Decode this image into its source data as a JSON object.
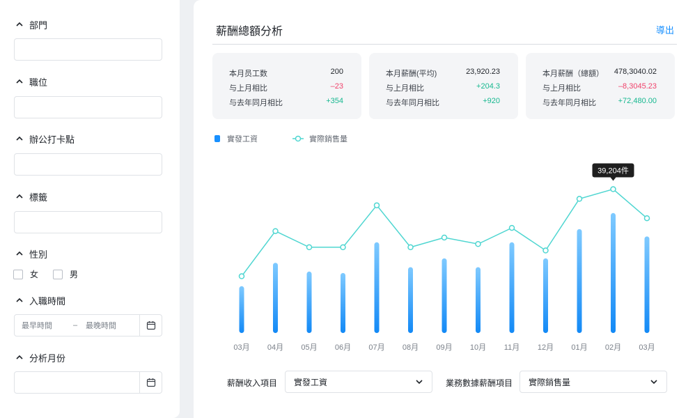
{
  "filters": {
    "department": {
      "title": "部門"
    },
    "position": {
      "title": "職位"
    },
    "office": {
      "title": "辦公打卡點"
    },
    "tags": {
      "title": "標籤"
    },
    "gender": {
      "title": "性別",
      "options": [
        "女",
        "男"
      ]
    },
    "hire_date": {
      "title": "入職時間",
      "start_placeholder": "最早時間",
      "separator": "–",
      "end_placeholder": "最晚時間"
    },
    "month": {
      "title": "分析月份"
    }
  },
  "header": {
    "title": "薪酬總額分析",
    "export_label": "導出"
  },
  "cards": [
    {
      "rows": [
        {
          "label": "本月员工数",
          "value": "200"
        },
        {
          "label": "与上月相比",
          "value": "–23"
        },
        {
          "label": "与去年同月相比",
          "value": "+354"
        }
      ]
    },
    {
      "rows": [
        {
          "label": "本月薪酬(平均)",
          "value": "23,920.23"
        },
        {
          "label": "与上月相比",
          "value": "+204.3"
        },
        {
          "label": "与去年同月相比",
          "value": "+920"
        }
      ]
    },
    {
      "rows": [
        {
          "label": "本月薪酬（總額）",
          "value": "478,3040.02"
        },
        {
          "label": "与上月相比",
          "value": "–8,3045.23"
        },
        {
          "label": "与去年同月相比",
          "value": "+72,480.00"
        }
      ]
    }
  ],
  "colors": {
    "accent": "#1890ff",
    "line": "#4fd6d1",
    "positive": "#17b890",
    "negative": "#f0426b"
  },
  "chart_data": {
    "type": "bar",
    "categories": [
      "03月",
      "04月",
      "05月",
      "06月",
      "07月",
      "08月",
      "09月",
      "10月",
      "11月",
      "12月",
      "01月",
      "02月",
      "03月"
    ],
    "series": [
      {
        "name": "實發工資",
        "type": "bar",
        "values": [
          32,
          48,
          42,
          41,
          62,
          45,
          51,
          45,
          62,
          51,
          71,
          82,
          66
        ]
      },
      {
        "name": "實際銷售量",
        "type": "line",
        "values": [
          15,
          29,
          24,
          24,
          37,
          24,
          27,
          25,
          30,
          23,
          39,
          42,
          33
        ]
      }
    ],
    "tooltip": "39,204件",
    "tooltip_index": 11,
    "legend": "top-left",
    "grid": false
  },
  "controls": {
    "income_label": "薪酬收入項目",
    "income_value": "實發工資",
    "business_label": "業務數據薪酬項目",
    "business_value": "實際銷售量"
  }
}
